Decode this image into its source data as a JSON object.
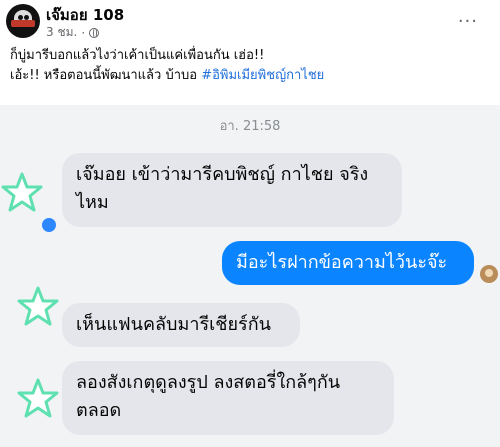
{
  "post": {
    "author": "เจ๊มอย 108",
    "time": "3 ชม.",
    "caption_line1": "ก็บู่มารีบอกแล้วไงว่าเค้าเป็นแค่เพื่อนกัน เฮ่อ!!",
    "caption_line2_text": "เอ้ะ!! หรือตอนนี้พัฒนาแล้ว บ้าบอ ",
    "hashtag": "#อิพิมเมียพิชญ์กาไชย",
    "more_label": "..."
  },
  "chat": {
    "timestamp": "อา. 21:58",
    "messages": [
      {
        "dir": "in",
        "line1": "เจ๊มอย เข้าว่ามารีคบพิชญ์ กาไชย จริง",
        "line2": "ไหม"
      },
      {
        "dir": "out",
        "line1": "มีอะไรฝากข้อความไว้นะจ๊ะ"
      },
      {
        "dir": "in",
        "line1": "เห็นแฟนคลับมารีเชียร์กัน"
      },
      {
        "dir": "in",
        "line1": "ลองสังเกตุดูลงรูป ลงสตอรี่ใกล้ๆกัน",
        "line2": "ตลอด"
      }
    ]
  },
  "colors": {
    "hashtag": "#216fdb",
    "outgoing": "#0a84ff",
    "incoming": "#e4e6eb",
    "glow": "#5fe0b0"
  }
}
